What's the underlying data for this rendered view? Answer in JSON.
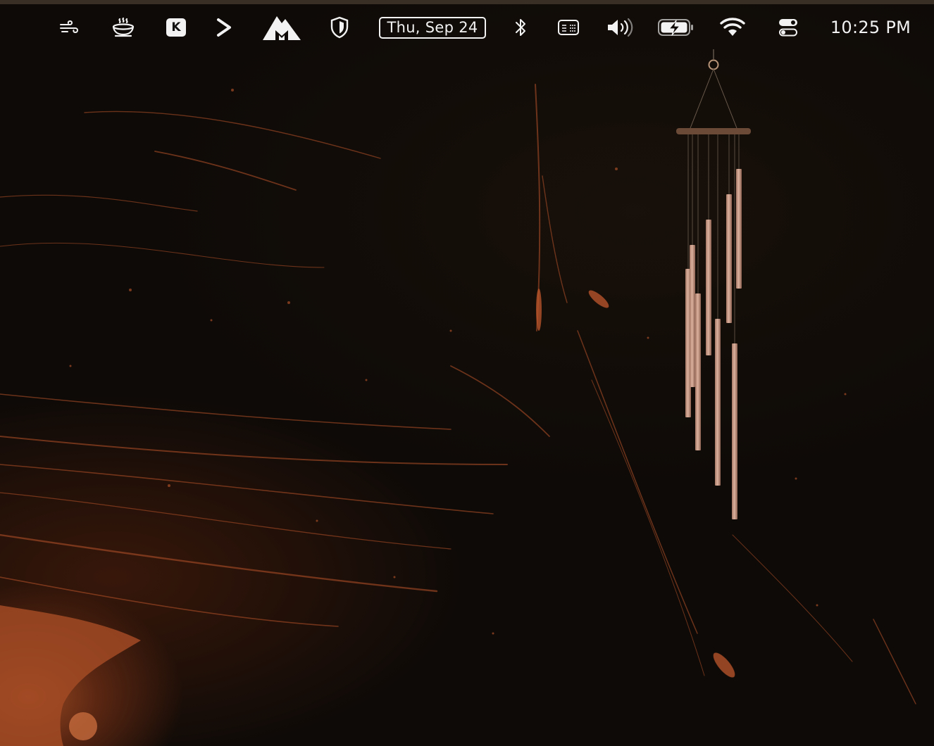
{
  "menubar": {
    "items": [
      {
        "name": "wind-icon"
      },
      {
        "name": "coffee-cup-icon"
      },
      {
        "name": "k-app-icon",
        "label": "K"
      },
      {
        "name": "play-arrow-icon"
      },
      {
        "name": "mountain-m-icon",
        "label": "M"
      },
      {
        "name": "shield-icon"
      },
      {
        "name": "date-widget"
      },
      {
        "name": "bluetooth-icon"
      },
      {
        "name": "keyboard-shortcuts-icon"
      },
      {
        "name": "volume-icon"
      },
      {
        "name": "battery-charging-icon"
      },
      {
        "name": "wifi-icon"
      },
      {
        "name": "control-center-icon"
      },
      {
        "name": "clock"
      }
    ],
    "date": "Thu, Sep 24",
    "time": "10:25 PM",
    "k_label": "K",
    "m_label": "M",
    "text_color": "#f2f2f2"
  },
  "wallpaper": {
    "description_colors": {
      "background": "#0e0a07",
      "accent": "#b8532a"
    }
  },
  "widgets": {
    "wind_chime": {
      "name": "wind-chime-widget",
      "tube_color": "#c99a82",
      "bar_color": "#6b4a38"
    }
  }
}
